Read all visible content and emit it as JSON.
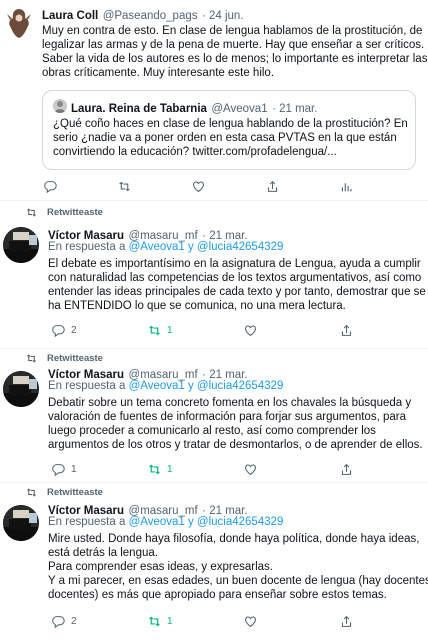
{
  "tweet1": {
    "author": "Laura Coll",
    "handle": "@Paseando_pags",
    "date": "· 24 jun.",
    "lines": [
      "Muy en contra de esto. En clase de lengua hablamos de la prostitución, de",
      "legalizar las armas y de la pena de muerte. Hay que enseñar a ser críticos.",
      "Saber la vida de los autores es lo de menos; lo importante es interpretar las",
      "obras críticamente. Muy  interesante este hilo."
    ],
    "quote": {
      "author": "Laura. Reina de Tabarnia",
      "handle": "@Aveova1",
      "date": "· 21 mar.",
      "lines": [
        "¿Qué coño haces en clase de lengua hablando de la prostitución? En",
        "serio ¿nadie va a poner orden en esta casa PVTAS en la que están",
        "convirtiendo la educación? twitter.com/profadelengua/..."
      ]
    }
  },
  "retweet_label": "Retwitteaste",
  "reply_prefix": "En respuesta a ",
  "reply_targets": "@Aveova1 y @lucia42654329",
  "tweets": [
    {
      "author": "Víctor Masaru",
      "handle": "@masaru_mf",
      "date": "· 21 mar.",
      "lines": [
        "El debate es importantísimo en la asignatura de Lengua, ayuda a cumplir",
        "con naturalidad las competencias de los textos argumentativos, así como",
        "entender las ideas principales de cada texto y por tanto, demostrar que se",
        "ha ENTENDIDO lo que se comunica, no una mera lectura."
      ],
      "reply_count": "2",
      "retweet_count": "1",
      "like_count": ""
    },
    {
      "author": "Víctor Masaru",
      "handle": "@masaru_mf",
      "date": "· 21 mar.",
      "lines": [
        "Debatir sobre un tema concreto fomenta en los chavales la búsqueda y",
        "valoración de fuentes de información para forjar sus argumentos, para",
        "luego proceder a comunicarlo al resto, así como comprender los",
        "argumentos de los otros y tratar de desmontarlos, o de aprender de ellos."
      ],
      "reply_count": "1",
      "retweet_count": "1",
      "like_count": ""
    },
    {
      "author": "Víctor Masaru",
      "handle": "@masaru_mf",
      "date": "· 21 mar.",
      "lines": [
        "Mire usted. Donde haya filosofía, donde haya política, donde haya ideas,",
        "está detrás la lengua.",
        "Para comprender esas ideas, y expresarlas.",
        "Y a mi parecer, en esas edades, un buen docente de lengua (hay docentes y",
        "docentes) es más que apropiado para enseñar sobre estos temas."
      ],
      "reply_count": "2",
      "retweet_count": "1",
      "like_count": ""
    }
  ],
  "colors": {
    "accent": "#1d9bf0",
    "retweet_green": "#00ba7c",
    "muted": "#536471"
  }
}
